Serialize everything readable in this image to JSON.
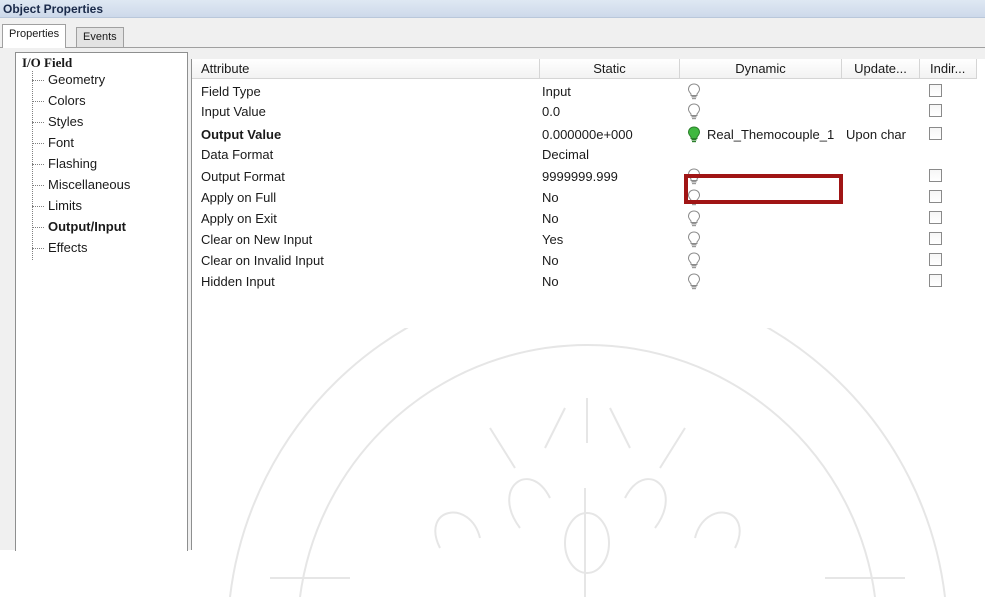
{
  "window": {
    "title": "Object Properties"
  },
  "tabs": [
    {
      "label": "Properties",
      "active": true
    },
    {
      "label": "Events",
      "active": false
    }
  ],
  "tree": {
    "root": "I/O Field",
    "items": [
      "Geometry",
      "Colors",
      "Styles",
      "Font",
      "Flashing",
      "Miscellaneous",
      "Limits",
      "Output/Input",
      "Effects"
    ],
    "selected": "Output/Input"
  },
  "grid": {
    "headers": {
      "attribute": "Attribute",
      "static": "Static",
      "dynamic": "Dynamic",
      "update": "Update...",
      "indirect": "Indir..."
    },
    "rows": [
      {
        "attribute": "Field Type",
        "static": "Input",
        "dynamic": "",
        "update": "",
        "bulb": "bulb-icon",
        "checkbox": true
      },
      {
        "attribute": "Input Value",
        "static": "0.0",
        "dynamic": "",
        "update": "",
        "bulb": "bulb-icon",
        "checkbox": true
      },
      {
        "attribute": "Output Value",
        "static": "0.000000e+000",
        "dynamic": "Real_Themocouple_1",
        "update": "Upon char",
        "bulb": "bulb-green-icon",
        "checkbox": true,
        "bold": true
      },
      {
        "attribute": "Data Format",
        "static": "Decimal",
        "dynamic": "",
        "update": "",
        "bulb": "",
        "checkbox": false
      },
      {
        "attribute": "Output Format",
        "static": "9999999.999",
        "dynamic": "",
        "update": "",
        "bulb": "bulb-icon",
        "checkbox": true
      },
      {
        "attribute": "Apply on Full",
        "static": "No",
        "dynamic": "",
        "update": "",
        "bulb": "bulb-icon",
        "checkbox": true
      },
      {
        "attribute": "Apply on Exit",
        "static": "No",
        "dynamic": "",
        "update": "",
        "bulb": "bulb-icon",
        "checkbox": true
      },
      {
        "attribute": "Clear on New Input",
        "static": "Yes",
        "dynamic": "",
        "update": "",
        "bulb": "bulb-icon",
        "checkbox": true
      },
      {
        "attribute": "Clear on Invalid Input",
        "static": "No",
        "dynamic": "",
        "update": "",
        "bulb": "bulb-icon",
        "checkbox": true
      },
      {
        "attribute": "Hidden Input",
        "static": "No",
        "dynamic": "",
        "update": "",
        "bulb": "bulb-icon",
        "checkbox": true
      }
    ]
  },
  "colors": {
    "highlight": "#a01515",
    "bulb_active": "#3fb83f"
  }
}
